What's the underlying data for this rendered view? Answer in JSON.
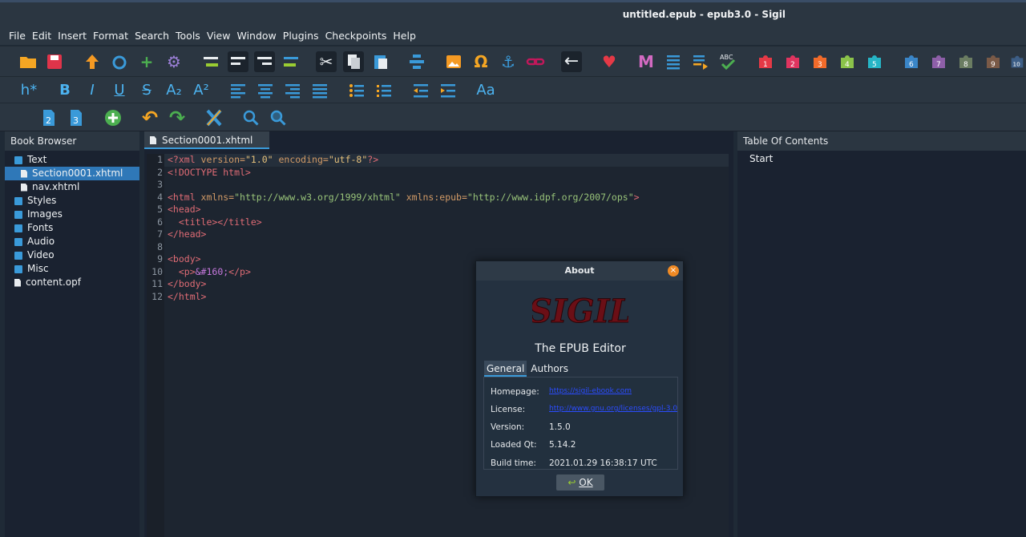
{
  "window": {
    "title": "untitled.epub - epub3.0 - Sigil"
  },
  "menu": [
    "File",
    "Edit",
    "Insert",
    "Format",
    "Search",
    "Tools",
    "View",
    "Window",
    "Plugins",
    "Checkpoints",
    "Help"
  ],
  "toolbar2": {
    "heading": "h*",
    "bold": "B",
    "italic": "I",
    "underline": "U",
    "strike": "S",
    "sub": "A₂",
    "sup": "A²",
    "case": "Aa"
  },
  "plugins": [
    "1",
    "2",
    "3",
    "4",
    "5",
    "6",
    "7",
    "8",
    "9",
    "10"
  ],
  "book_browser": {
    "title": "Book Browser",
    "items": [
      "Text",
      "Section0001.xhtml",
      "nav.xhtml",
      "Styles",
      "Images",
      "Fonts",
      "Audio",
      "Video",
      "Misc",
      "content.opf"
    ]
  },
  "editor": {
    "tab": "Section0001.xhtml",
    "line_numbers": [
      "1",
      "2",
      "3",
      "4",
      "5",
      "6",
      "7",
      "8",
      "9",
      "10",
      "11",
      "12"
    ],
    "code": {
      "l1": {
        "a": "<?xml ",
        "b": "version=",
        "c": "\"1.0\"",
        "d": " encoding=",
        "e": "\"utf-8\"",
        "f": "?>"
      },
      "l2": "<!DOCTYPE html>",
      "l4": {
        "a": "<html ",
        "b": "xmlns=",
        "c": "\"http://www.w3.org/1999/xhtml\"",
        "d": " xmlns:epub=",
        "e": "\"http://www.idpf.org/2007/ops\"",
        "f": ">"
      },
      "l5": "<head>",
      "l6": "  <title></title>",
      "l7": "</head>",
      "l9": "<body>",
      "l10": {
        "a": "  <p>",
        "b": "&#160;",
        "c": "</p>"
      },
      "l11": "</body>",
      "l12": "</html>"
    }
  },
  "toc": {
    "title": "Table Of Contents",
    "items": [
      "Start"
    ]
  },
  "about": {
    "title": "About",
    "close": "×",
    "subtitle": "The EPUB Editor",
    "tabs": [
      "General",
      "Authors"
    ],
    "rows": {
      "homepage": {
        "label": "Homepage:",
        "value": "https://sigil-ebook.com"
      },
      "license": {
        "label": "License:",
        "value": "http://www.gnu.org/licenses/gpl-3.0"
      },
      "version": {
        "label": "Version:",
        "value": "1.5.0"
      },
      "qt": {
        "label": "Loaded Qt:",
        "value": "5.14.2"
      },
      "build": {
        "label": "Build time:",
        "value": "2021.01.29 16:38:17 UTC"
      }
    },
    "ok": "OK"
  },
  "colors": {
    "accent": "#3a9ad9",
    "selection": "#2f78b8",
    "close": "#f08a24"
  }
}
